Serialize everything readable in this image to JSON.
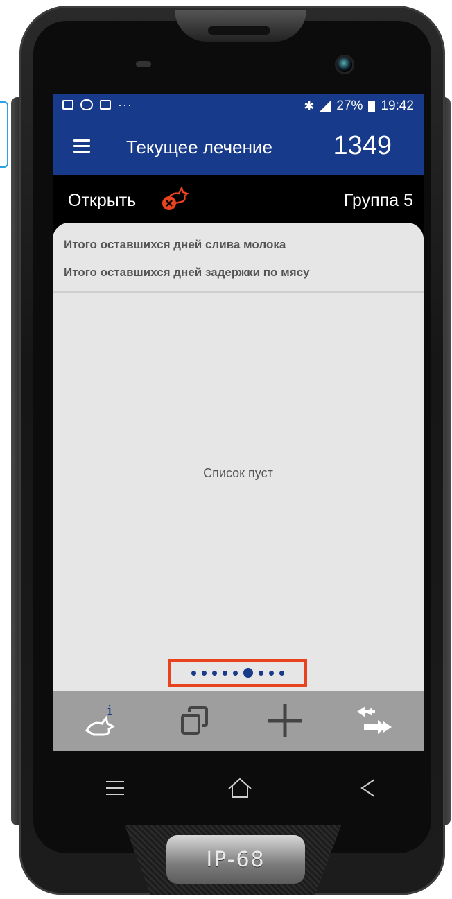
{
  "statusbar": {
    "dots": "···",
    "battery_percent": "27%",
    "time": "19:42"
  },
  "appbar": {
    "title": "Текущее лечение",
    "count": "1349"
  },
  "infobar": {
    "open_label": "Открыть",
    "group_label": "Группа 5"
  },
  "summary": {
    "milk_line": "Итого оставшихся дней слива молока",
    "meat_line": "Итого оставшихся дней задержки по мясу"
  },
  "list": {
    "empty_text": "Список пуст"
  },
  "pager": {
    "total_pages": 9,
    "active_page": 6
  },
  "device": {
    "badge": "IP-68"
  },
  "colors": {
    "appbar": "#173a8a",
    "highlight": "#e8431e",
    "toolbar": "#9e9e9e"
  }
}
